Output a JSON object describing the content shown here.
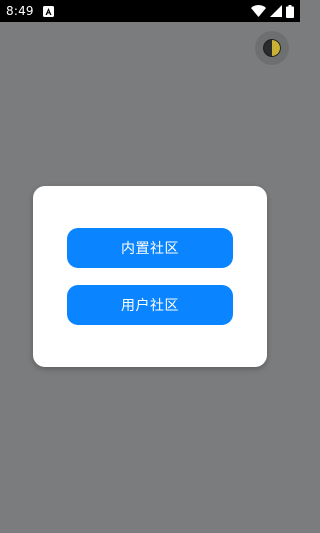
{
  "status_bar": {
    "time": "8:49",
    "icons": [
      "notification-a-icon",
      "wifi-icon",
      "signal-icon",
      "battery-icon"
    ]
  },
  "theme_toggle": {
    "icon": "half-moon-theme-icon"
  },
  "dialog": {
    "buttons": [
      {
        "label": "内置社区"
      },
      {
        "label": "用户社区"
      }
    ]
  },
  "colors": {
    "primary_button": "#0a84ff",
    "scrim": "#7b7c7e",
    "status_bar": "#000000"
  }
}
